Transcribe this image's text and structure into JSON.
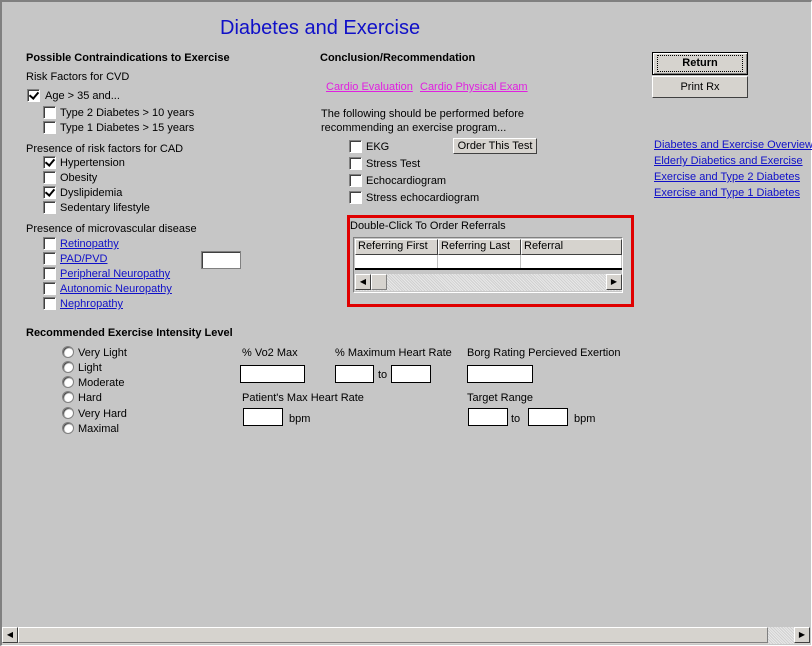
{
  "page": {
    "title": "Diabetes and Exercise"
  },
  "contraindications": {
    "heading": "Possible Contraindications to Exercise",
    "cvd": {
      "label": "Risk Factors for CVD",
      "items": [
        {
          "label": "Age > 35 and...",
          "checked": true
        },
        {
          "label": "Type 2 Diabetes > 10 years",
          "checked": false
        },
        {
          "label": "Type 1 Diabetes > 15 years",
          "checked": false
        }
      ]
    },
    "cad": {
      "label": "Presence of risk factors for CAD",
      "items": [
        {
          "label": "Hypertension",
          "checked": true
        },
        {
          "label": "Obesity",
          "checked": false
        },
        {
          "label": "Dyslipidemia",
          "checked": true
        },
        {
          "label": "Sedentary lifestyle",
          "checked": false
        }
      ]
    },
    "micro": {
      "label": "Presence of microvascular disease",
      "items": [
        {
          "label": "Retinopathy",
          "checked": false
        },
        {
          "label": "PAD/PVD",
          "checked": false
        },
        {
          "label": "Peripheral Neuropathy",
          "checked": false
        },
        {
          "label": "Autonomic Neuropathy",
          "checked": false
        },
        {
          "label": "Nephropathy",
          "checked": false
        }
      ],
      "pad_value": ""
    }
  },
  "conclusion": {
    "heading": "Conclusion/Recommendation",
    "links": [
      "Cardio Evaluation",
      "Cardio Physical Exam"
    ],
    "instruction_line1": "The following should be performed before",
    "instruction_line2": "recommending an exercise program...",
    "tests": [
      {
        "label": "EKG",
        "checked": false
      },
      {
        "label": "Stress Test",
        "checked": false
      },
      {
        "label": "Echocardiogram",
        "checked": false
      },
      {
        "label": "Stress echocardiogram",
        "checked": false
      }
    ],
    "order_button": "Order This Test",
    "referrals": {
      "label": "Double-Click To Order Referrals",
      "columns": [
        "Referring First",
        "Referring Last",
        "Referral"
      ],
      "rows": []
    }
  },
  "actions": {
    "return": "Return",
    "print": "Print Rx"
  },
  "side_links": [
    "Diabetes and Exercise Overview",
    "Elderly Diabetics and Exercise",
    "Exercise and Type 2 Diabetes",
    "Exercise and Type 1 Diabetes"
  ],
  "intensity": {
    "heading": "Recommended Exercise Intensity Level",
    "options": [
      "Very Light",
      "Light",
      "Moderate",
      "Hard",
      "Very Hard",
      "Maximal"
    ],
    "selected": null,
    "vo2_label": "% Vo2 Max",
    "vo2_value": "",
    "mhr_label": "% Maximum Heart Rate",
    "mhr_from": "",
    "mhr_to": "",
    "to_label": "to",
    "borg_label": "Borg Rating Percieved Exertion",
    "borg_value": "",
    "pmhr_label": "Patient's Max Heart Rate",
    "pmhr_value": "",
    "bpm_label": "bpm",
    "target_label": "Target Range",
    "target_from": "",
    "target_to": ""
  },
  "colors": {
    "title": "#1010c8",
    "link": "#1010c8",
    "magenta_link": "#e020e0",
    "highlight": "#e00000",
    "background": "#c6c6c6"
  }
}
